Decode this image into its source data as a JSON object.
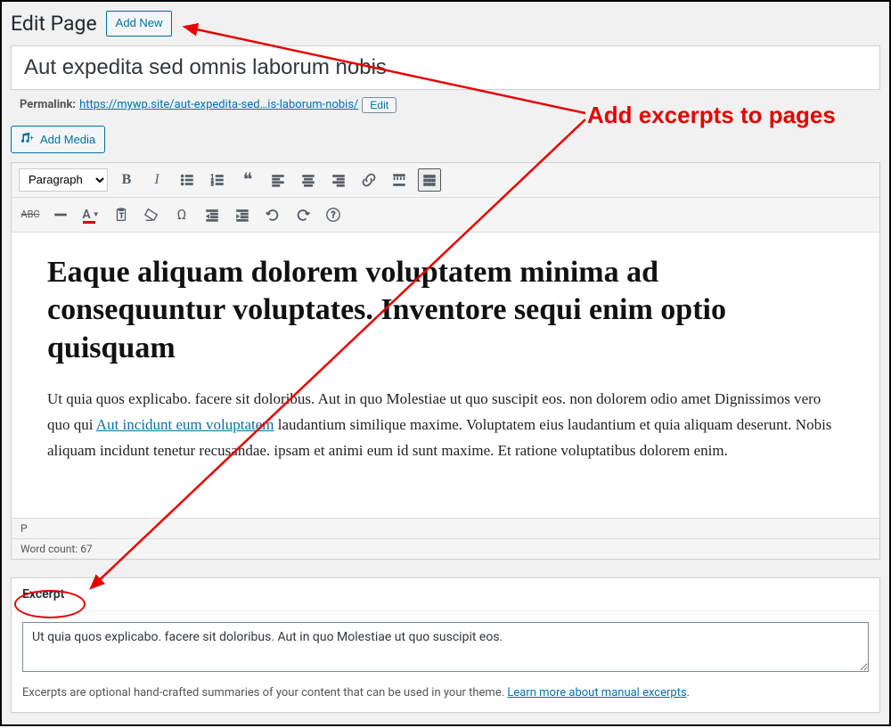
{
  "header": {
    "title": "Edit Page",
    "add_new": "Add New"
  },
  "post": {
    "title": "Aut expedita sed omnis laborum nobis",
    "permalink_label": "Permalink:",
    "permalink_url": "https://mywp.site/aut-expedita-sed…is-laborum-nobis/",
    "permalink_edit": "Edit"
  },
  "media": {
    "add_media": "Add Media"
  },
  "toolbar": {
    "format": "Paragraph",
    "abc": "ABC"
  },
  "content": {
    "heading": "Eaque aliquam dolorem voluptatem minima ad consequuntur voluptates. Inventore sequi enim optio quisquam",
    "para_pre": "Ut quia quos explicabo. facere sit doloribus. Aut in quo Molestiae ut quo suscipit eos. non dolorem odio amet Dignissimos vero quo qui ",
    "para_link": "Aut incidunt eum voluptatem",
    "para_post": " laudantium similique maxime. Voluptatem eius laudantium et quia aliquam deserunt. Nobis aliquam incidunt tenetur recusandae. ipsam et animi eum id sunt maxime. Et ratione voluptatibus dolorem enim."
  },
  "status": {
    "path": "P",
    "word_count_label": "Word count: ",
    "word_count": "67"
  },
  "excerpt": {
    "title": "Excerpt",
    "value": "Ut quia quos explicabo. facere sit doloribus. Aut in quo Molestiae ut quo suscipit eos.",
    "help_pre": "Excerpts are optional hand-crafted summaries of your content that can be used in your theme. ",
    "help_link": "Learn more about manual excerpts",
    "help_post": "."
  },
  "annotation": {
    "label": "Add excerpts to pages"
  }
}
